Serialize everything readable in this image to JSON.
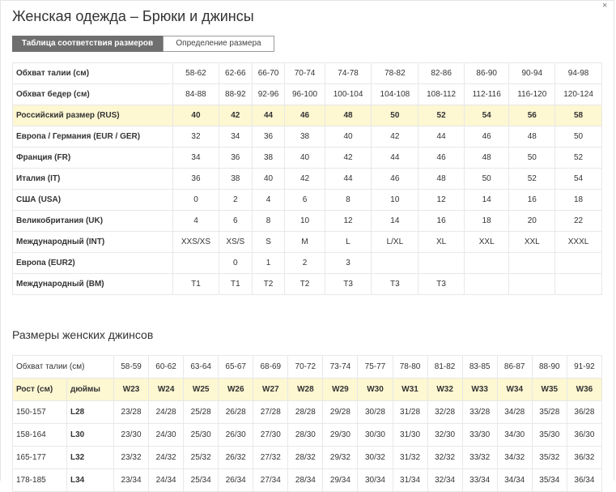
{
  "title": "Женская одежда – Брюки и джинсы",
  "tabs": [
    {
      "label": "Таблица соответствия размеров"
    },
    {
      "label": "Определение размера"
    }
  ],
  "close_glyph": "×",
  "table1": {
    "rows": [
      {
        "label": "Обхват талии (см)",
        "cells": [
          "58-62",
          "62-66",
          "66-70",
          "70-74",
          "74-78",
          "78-82",
          "82-86",
          "86-90",
          "90-94",
          "94-98"
        ]
      },
      {
        "label": "Обхват бедер (см)",
        "cells": [
          "84-88",
          "88-92",
          "92-96",
          "96-100",
          "100-104",
          "104-108",
          "108-112",
          "112-116",
          "116-120",
          "120-124"
        ]
      },
      {
        "label": "Российский размер (RUS)",
        "cells": [
          "40",
          "42",
          "44",
          "46",
          "48",
          "50",
          "52",
          "54",
          "56",
          "58"
        ],
        "highlight": true
      },
      {
        "label": "Европа / Германия (EUR / GER)",
        "cells": [
          "32",
          "34",
          "36",
          "38",
          "40",
          "42",
          "44",
          "46",
          "48",
          "50"
        ]
      },
      {
        "label": "Франция (FR)",
        "cells": [
          "34",
          "36",
          "38",
          "40",
          "42",
          "44",
          "46",
          "48",
          "50",
          "52"
        ]
      },
      {
        "label": "Италия (IT)",
        "cells": [
          "36",
          "38",
          "40",
          "42",
          "44",
          "46",
          "48",
          "50",
          "52",
          "54"
        ]
      },
      {
        "label": "США (USA)",
        "cells": [
          "0",
          "2",
          "4",
          "6",
          "8",
          "10",
          "12",
          "14",
          "16",
          "18"
        ]
      },
      {
        "label": "Великобритания (UK)",
        "cells": [
          "4",
          "6",
          "8",
          "10",
          "12",
          "14",
          "16",
          "18",
          "20",
          "22"
        ]
      },
      {
        "label": "Международный (INT)",
        "cells": [
          "XXS/XS",
          "XS/S",
          "S",
          "M",
          "L",
          "L/XL",
          "XL",
          "XXL",
          "XXL",
          "XXXL"
        ]
      },
      {
        "label": "Европа (EUR2)",
        "cells": [
          "",
          "0",
          "1",
          "2",
          "3",
          "",
          "",
          "",
          "",
          ""
        ]
      },
      {
        "label": "Международный (BM)",
        "cells": [
          "T1",
          "T1",
          "T2",
          "T2",
          "T3",
          "T3",
          "T3",
          "",
          "",
          ""
        ]
      }
    ]
  },
  "jeans_title": "Размеры женских джинсов",
  "table2": {
    "waist_label": "Обхват талии (см)",
    "waist": [
      "58-59",
      "60-62",
      "63-64",
      "65-67",
      "68-69",
      "70-72",
      "73-74",
      "75-77",
      "78-80",
      "81-82",
      "83-85",
      "86-87",
      "88-90",
      "91-92"
    ],
    "height_label": "Рост (см)",
    "inches_label": "дюймы",
    "w_sizes": [
      "W23",
      "W24",
      "W25",
      "W26",
      "W27",
      "W28",
      "W29",
      "W30",
      "W31",
      "W32",
      "W33",
      "W34",
      "W35",
      "W36"
    ],
    "rows": [
      {
        "height": "150-157",
        "length": "L28",
        "cells": [
          "23/28",
          "24/28",
          "25/28",
          "26/28",
          "27/28",
          "28/28",
          "29/28",
          "30/28",
          "31/28",
          "32/28",
          "33/28",
          "34/28",
          "35/28",
          "36/28"
        ]
      },
      {
        "height": "158-164",
        "length": "L30",
        "cells": [
          "23/30",
          "24/30",
          "25/30",
          "26/30",
          "27/30",
          "28/30",
          "29/30",
          "30/30",
          "31/30",
          "32/30",
          "33/30",
          "34/30",
          "35/30",
          "36/30"
        ]
      },
      {
        "height": "165-177",
        "length": "L32",
        "cells": [
          "23/32",
          "24/32",
          "25/32",
          "26/32",
          "27/32",
          "28/32",
          "29/32",
          "30/32",
          "31/32",
          "32/32",
          "33/32",
          "34/32",
          "35/32",
          "36/32"
        ]
      },
      {
        "height": "178-185",
        "length": "L34",
        "cells": [
          "23/34",
          "24/34",
          "25/34",
          "26/34",
          "27/34",
          "28/34",
          "29/34",
          "30/34",
          "31/34",
          "32/34",
          "33/34",
          "34/34",
          "35/34",
          "36/34"
        ]
      }
    ]
  }
}
